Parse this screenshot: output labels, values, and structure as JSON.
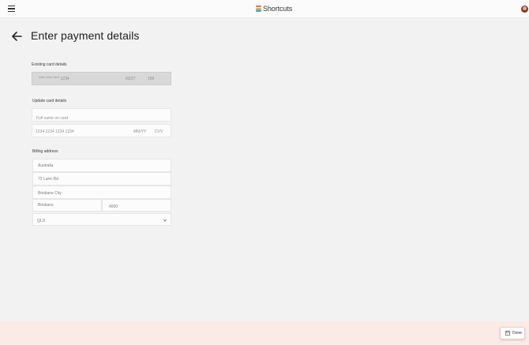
{
  "header": {
    "brand": "Shortcuts",
    "logo_colors": [
      "#e66b4b",
      "#f1b33c",
      "#56a7d7"
    ]
  },
  "page": {
    "title": "Enter payment details"
  },
  "existing_card": {
    "label": "Existing card details",
    "number": "**** **** **** 1234",
    "expiry": "03/27",
    "cvv": "199"
  },
  "update_card": {
    "label": "Update card details",
    "name_placeholder": "Full name on card",
    "number_placeholder": "1234 1234 1234 1234",
    "expiry_placeholder": "MM/YY",
    "cvv_placeholder": "CVV"
  },
  "billing": {
    "label": "Billing address",
    "country": "Australia",
    "street": "72 Lane Rd",
    "city": "Brisbane City",
    "suburb": "Brisbane",
    "postcode": "4000",
    "state": "QLD"
  },
  "footer": {
    "done_label": "Done"
  }
}
